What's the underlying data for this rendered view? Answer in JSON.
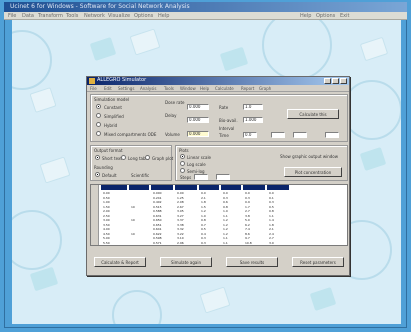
{
  "window": {
    "title": "Ucinet 6 for Windows - Software for Social Network Analysis",
    "menu": [
      "File",
      "Data",
      "Transform",
      "Tools",
      "Network",
      "Visualize",
      "Options",
      "Help"
    ],
    "right_menu": [
      "Help",
      "Options",
      "Exit"
    ]
  },
  "dialog": {
    "title": "ALLEGRO Simulator",
    "menu": [
      "File",
      "Edit",
      "Settings",
      "Analysis",
      "Tools",
      "Window",
      "Help",
      "Calculate",
      "Report",
      "Graph"
    ],
    "simulation_group": {
      "heading": "Simulation model",
      "options": [
        "Constant",
        "Simplified",
        "Hybrid",
        "Mixed compartments ODE"
      ],
      "selected": 0
    },
    "params": {
      "labels_left": [
        "Dose rate",
        "Delay",
        "Volume"
      ],
      "values_left": [
        "0.000",
        "0.000",
        "0.000"
      ],
      "labels_right": [
        "Rate",
        "Bio-avail.",
        "Time"
      ],
      "values_right": [
        "1.0",
        "1.000",
        "0.0"
      ],
      "extra_label": "Interval",
      "extra_values": [
        "",
        "",
        ""
      ],
      "calc_button": "Calculate this"
    },
    "output_group": {
      "heading": "Output format",
      "options": [
        "Short text",
        "Long table",
        "Graph plot"
      ],
      "sub_heading": "Rounding",
      "sub_options": [
        "Default",
        "Scientific"
      ]
    },
    "plot_group": {
      "heading": "Plots",
      "options": [
        "Linear scale",
        "Log scale",
        "Semi-log"
      ],
      "field_label": "Steps",
      "field_values": [
        "",
        ""
      ],
      "note": "Show graphic output window",
      "action_button": "Plot concentration"
    },
    "table": {
      "columns": [
        "Time",
        "Dose",
        "Conc",
        "Amount",
        "Rate",
        "Elim",
        "Cum",
        "AUC"
      ],
      "rows": [
        [
          "0.00",
          "",
          "0.000",
          "0.00",
          "0.0",
          "0.0",
          "0.0",
          "0.0"
        ],
        [
          "0.50",
          "",
          "0.241",
          "1.25",
          "2.1",
          "0.3",
          "0.3",
          "0.1"
        ],
        [
          "1.00",
          "",
          "0.402",
          "2.08",
          "1.8",
          "0.6",
          "0.9",
          "0.3"
        ],
        [
          "1.50",
          "10",
          "0.515",
          "2.67",
          "1.5",
          "0.8",
          "1.7",
          "0.5"
        ],
        [
          "2.00",
          "",
          "0.588",
          "3.05",
          "1.2",
          "1.0",
          "2.7",
          "0.8"
        ],
        [
          "2.50",
          "",
          "0.631",
          "3.27",
          "1.0",
          "1.1",
          "3.8",
          "1.1"
        ],
        [
          "3.00",
          "10",
          "0.650",
          "3.37",
          "0.8",
          "1.2",
          "5.0",
          "1.4"
        ],
        [
          "3.50",
          "",
          "0.651",
          "3.38",
          "0.7",
          "1.2",
          "6.2",
          "1.8"
        ],
        [
          "4.00",
          "",
          "0.641",
          "3.32",
          "0.5",
          "1.2",
          "7.4",
          "2.1"
        ],
        [
          "4.50",
          "10",
          "0.622",
          "3.22",
          "0.4",
          "1.2",
          "8.6",
          "2.4"
        ],
        [
          "5.00",
          "",
          "0.598",
          "3.10",
          "0.3",
          "1.1",
          "9.7",
          "2.7"
        ],
        [
          "5.50",
          "",
          "0.571",
          "2.96",
          "0.3",
          "1.1",
          "10.8",
          "3.0"
        ]
      ]
    },
    "footer_buttons": [
      "Calculate & Report",
      "Simulate again",
      "Save results",
      "Reset parameters"
    ]
  },
  "colors": {
    "desktop": "#4fa0d7",
    "dialog": "#d4d0c8",
    "titlebar": "#0a246a",
    "wallpaper": "#d8edf7"
  }
}
